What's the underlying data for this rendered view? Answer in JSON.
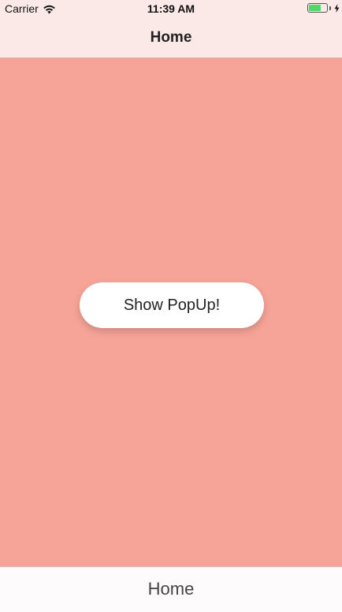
{
  "status_bar": {
    "carrier": "Carrier",
    "time": "11:39 AM",
    "battery_level": 0.7,
    "icons": [
      "wifi-icon",
      "battery-icon",
      "charging-bolt-icon"
    ]
  },
  "nav_bar": {
    "title": "Home"
  },
  "main": {
    "button_label": "Show PopUp!",
    "background_color": "#f7a498"
  },
  "bottom_bar": {
    "tab_label": "Home"
  }
}
